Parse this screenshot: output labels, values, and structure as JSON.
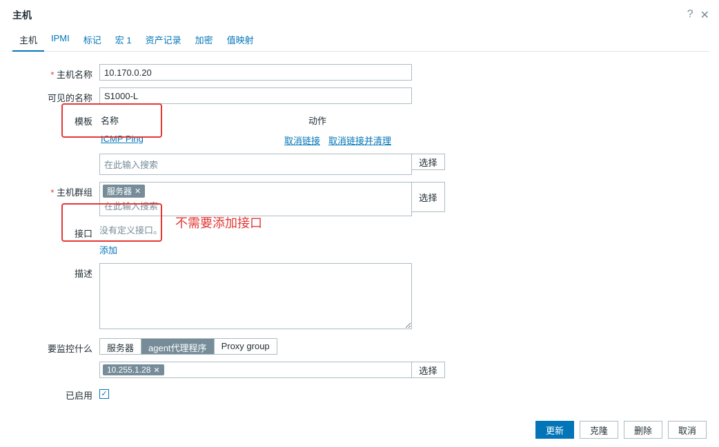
{
  "dialog": {
    "title": "主机",
    "help": "?",
    "close": "✕"
  },
  "tabs": [
    {
      "label": "主机",
      "active": true
    },
    {
      "label": "IPMI"
    },
    {
      "label": "标记"
    },
    {
      "label": "宏 1"
    },
    {
      "label": "资产记录"
    },
    {
      "label": "加密"
    },
    {
      "label": "值映射"
    }
  ],
  "labels": {
    "hostname": "主机名称",
    "visible": "可见的名称",
    "templates": "模板",
    "tpl_name": "名称",
    "tpl_action": "动作",
    "tpl_search": "在此输入搜索",
    "groups": "主机群组",
    "grp_search": "在此输入搜索",
    "iface": "接口",
    "iface_none": "没有定义接口。",
    "iface_add": "添加",
    "desc": "描述",
    "monitor": "要监控什么",
    "enabled": "已启用",
    "select": "选择"
  },
  "values": {
    "hostname": "10.170.0.20",
    "visible": "S1000-L",
    "template": "ICMP Ping",
    "tpl_unlink": "取消链接",
    "tpl_unlink_clear": "取消链接并清理",
    "group_tag": "服务器",
    "proxy_tag": "10.255.1.28"
  },
  "monitor_opts": [
    {
      "label": "服务器"
    },
    {
      "label": "agent代理程序",
      "on": true
    },
    {
      "label": "Proxy group"
    }
  ],
  "annotation": "不需要添加接口",
  "buttons": {
    "update": "更新",
    "clone": "克隆",
    "delete": "删除",
    "cancel": "取消"
  }
}
